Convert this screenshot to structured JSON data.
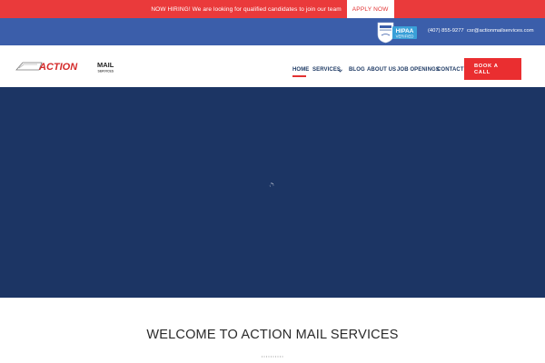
{
  "announcement": {
    "text": "NOW HIRING! We are looking for qualified candidates to join our team",
    "button_label": "APPLY NOW"
  },
  "topbar": {
    "phone": "(407) 855-9277",
    "email": "csr@actionmailservices.com",
    "badge": {
      "icon": "hipaa-verified-badge",
      "label": "HIPAA",
      "sublabel": "VERIFIED"
    }
  },
  "logo": {
    "text_main": "ACTION",
    "text_accent": "MAIL",
    "text_sub": "SERVICES"
  },
  "nav": {
    "items": [
      {
        "label": "HOME",
        "active": true
      },
      {
        "label": "SERVICES",
        "has_dropdown": true
      },
      {
        "label": "BLOG"
      },
      {
        "label": "ABOUT US"
      },
      {
        "label": "JOB OPENINGS"
      },
      {
        "label": "CONTACT"
      }
    ],
    "cta_line1": "BOOK A",
    "cta_line2": "CALL"
  },
  "main": {
    "welcome_title": "WELCOME TO ACTION MAIL SERVICES"
  },
  "colors": {
    "announce_bg": "#ea3a3b",
    "topbar_bg": "#3b5eaa",
    "hero_bg": "#1c3564",
    "accent": "#e23232",
    "nav_text": "#1e3a64"
  }
}
